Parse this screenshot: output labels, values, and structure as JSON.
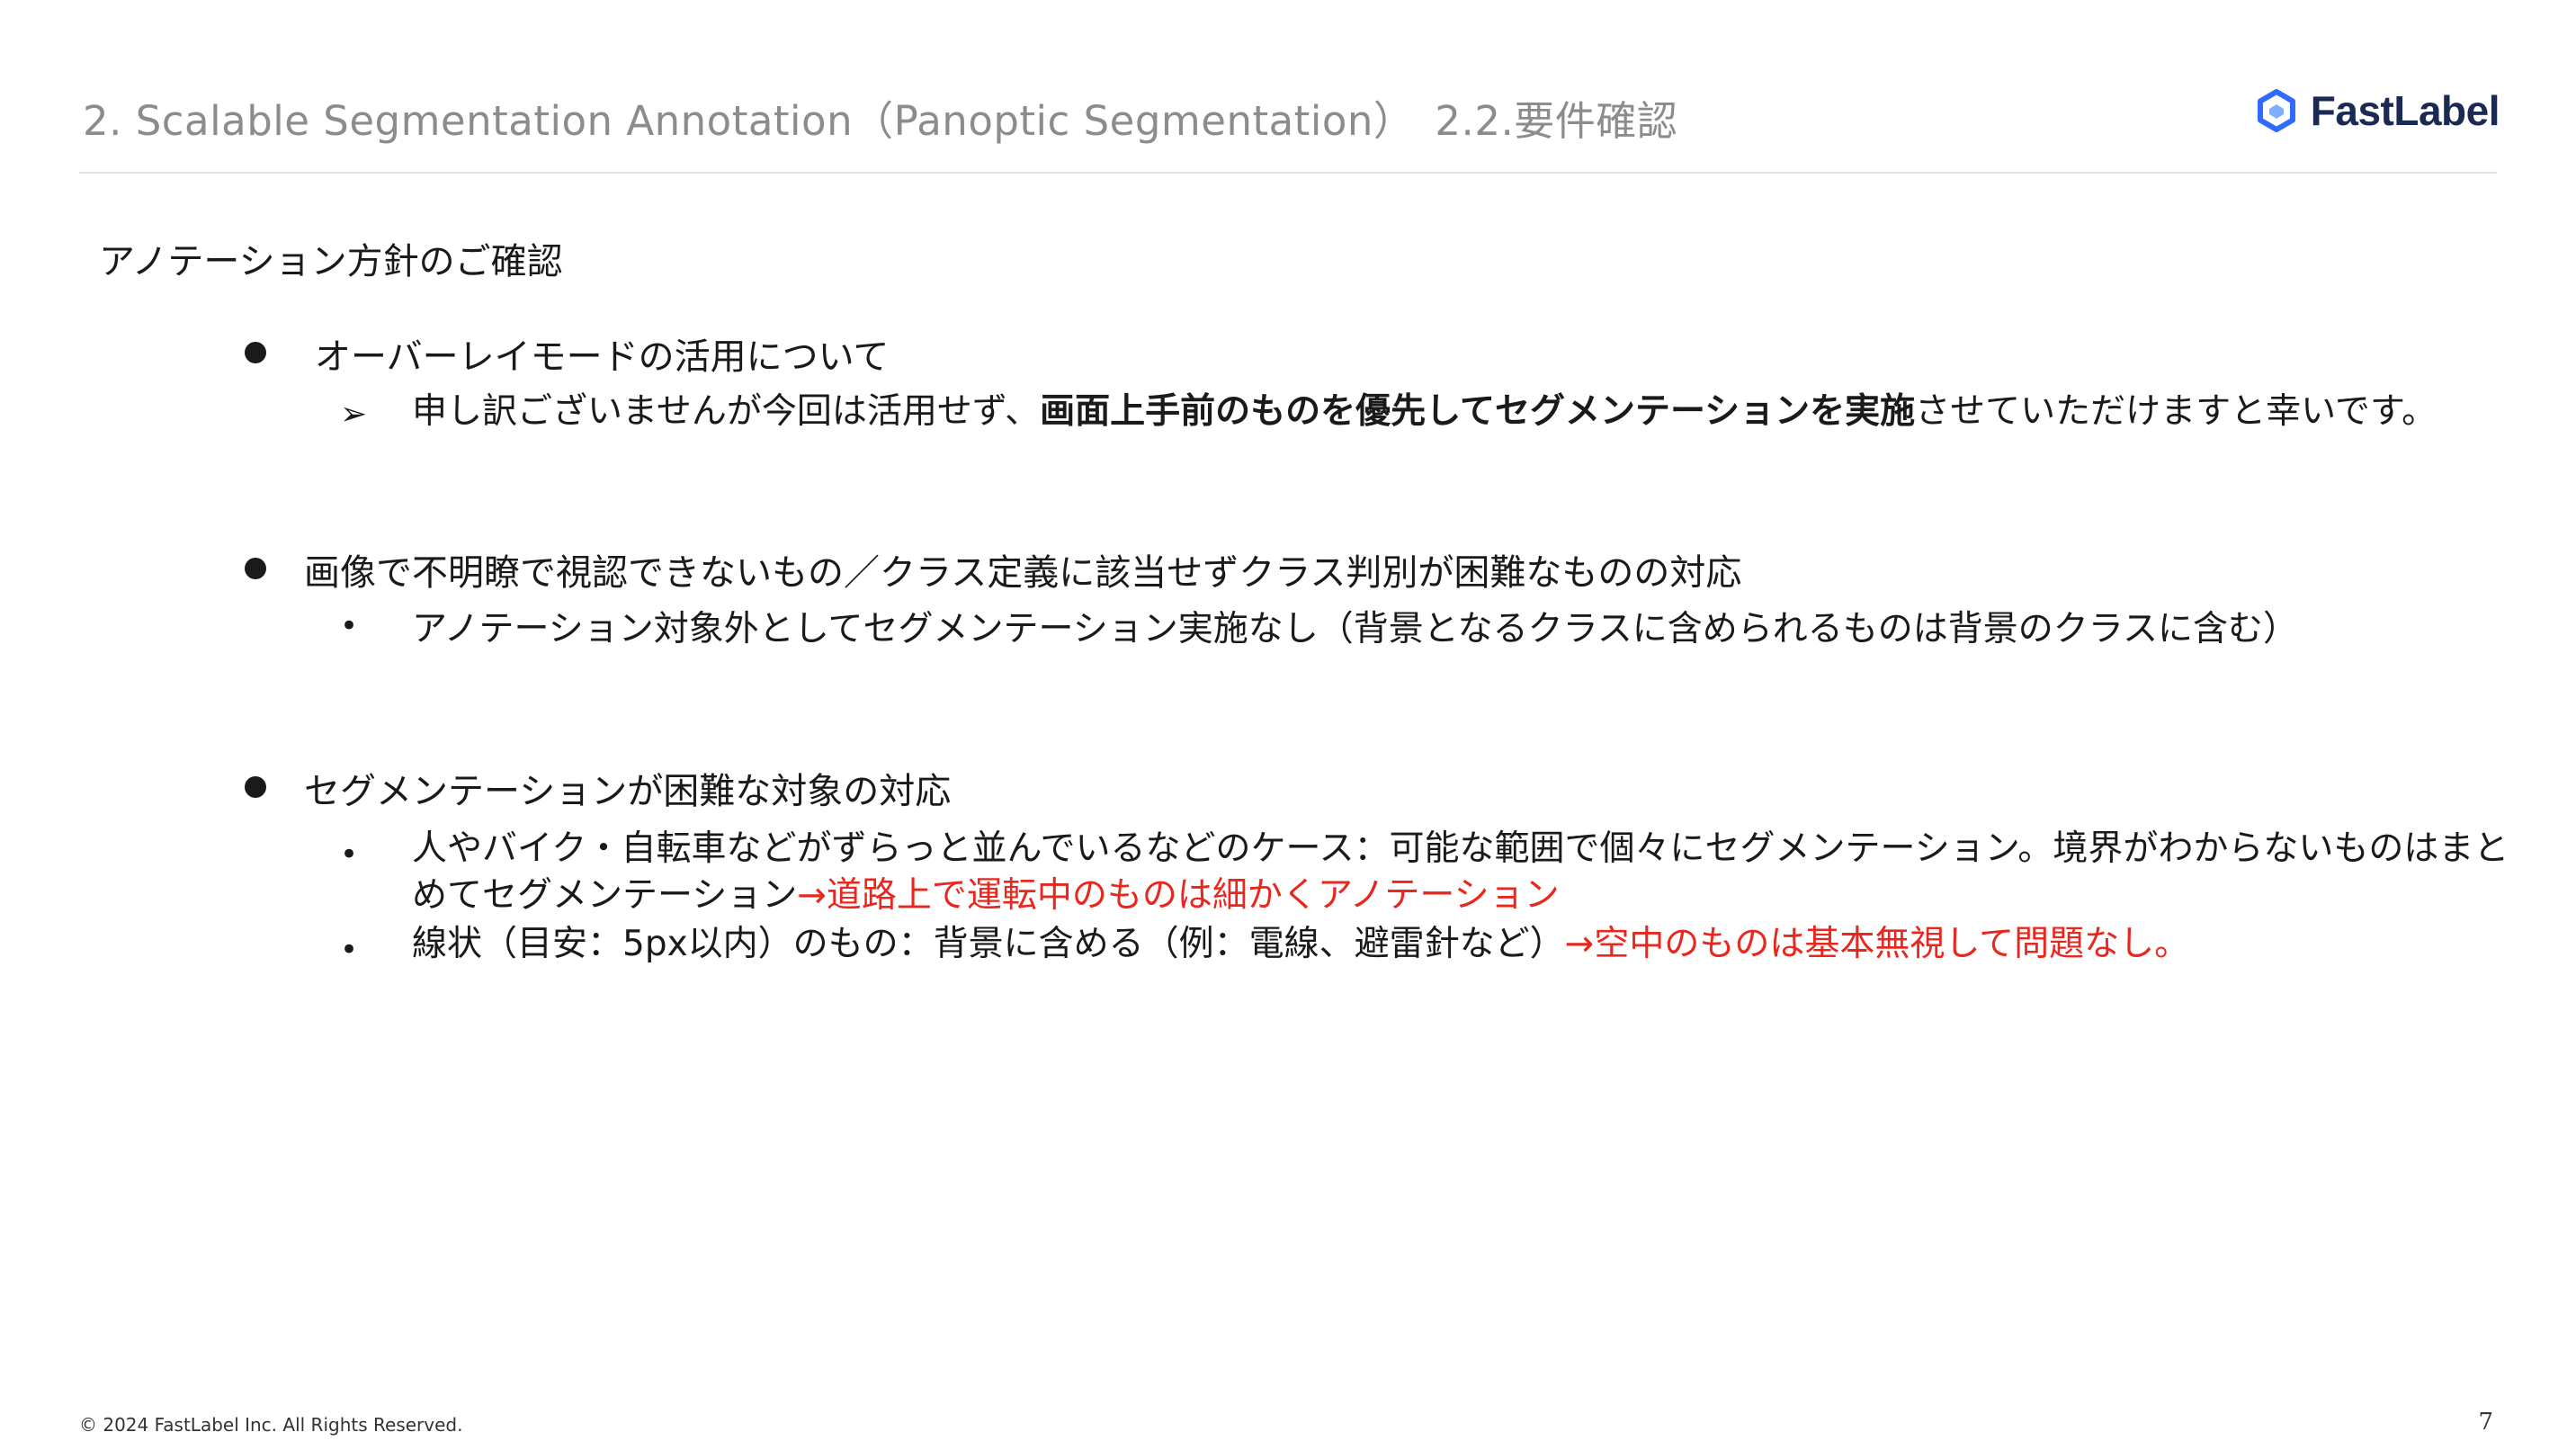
{
  "header": {
    "title": "2. Scalable Segmentation Annotation（Panoptic Segmentation）　2.2.要件確認",
    "logo_text": "FastLabel",
    "logo_icon": "fastlabel-hexagon-logo",
    "logo_color": "#2f6bff"
  },
  "section_heading": "アノテーション方針のご確認",
  "points": [
    {
      "label": "オーバーレイモードの活用について",
      "sub": {
        "marker": "➢",
        "text_before": "申し訳ございませんが今回は活用せず、",
        "text_bold": "画面上手前のものを優先してセグメンテーションを実施",
        "text_after": "させていただけますと幸いです。"
      }
    },
    {
      "label": "画像で不明瞭で視認できないもの／クラス定義に該当せずクラス判別が困難なものの対応",
      "sub": {
        "marker": "•",
        "text": "アノテーション対象外としてセグメンテーション実施なし（背景となるクラスに含められるものは背景のクラスに含む）"
      }
    },
    {
      "label": "セグメンテーションが困難な対象の対応",
      "subs": [
        {
          "marker": "•",
          "line1": "人やバイク・自転車などがずらっと並んでいるなどのケース：可能な範囲で個々にセグメンテーション。境界がわからないものはまと",
          "line2": "めてセグメンテーション",
          "red": "→道路上で運転中のものは細かくアノテーション"
        },
        {
          "marker": "•",
          "text": "線状（目安：5px以内）のもの：背景に含める（例：電線、避雷針など）",
          "red": "→空中のものは基本無視して問題なし。"
        }
      ]
    }
  ],
  "footer": {
    "copyright": "© 2024 FastLabel Inc. All Rights Reserved.",
    "page_number": "7"
  },
  "colors": {
    "highlight_red": "#e8281f",
    "header_gray": "#8c8c8c",
    "text": "#1a1a1a"
  }
}
